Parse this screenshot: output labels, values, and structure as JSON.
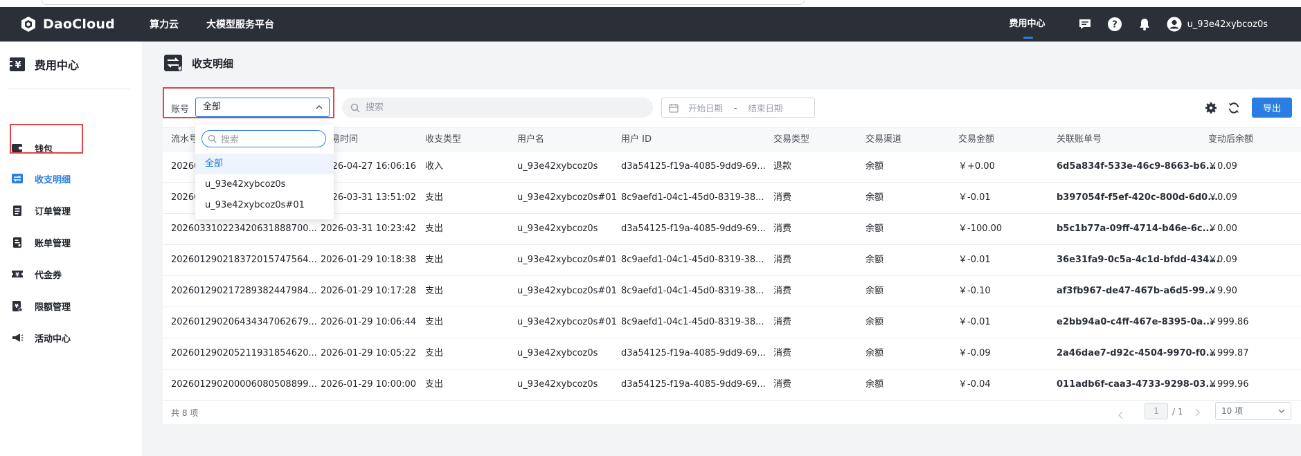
{
  "brand": {
    "name": "DaoCloud"
  },
  "topnav": {
    "items": [
      "算力云",
      "大模型服务平台"
    ]
  },
  "topright": {
    "cost_center": "费用中心",
    "username": "u_93e42xybcoz0s"
  },
  "sidebar": {
    "title": "费用中心",
    "items": [
      {
        "label": "钱包",
        "icon": "wallet-icon"
      },
      {
        "label": "收支明细",
        "icon": "transactions-icon"
      },
      {
        "label": "订单管理",
        "icon": "order-icon"
      },
      {
        "label": "账单管理",
        "icon": "bill-icon"
      },
      {
        "label": "代金券",
        "icon": "voucher-icon"
      },
      {
        "label": "限额管理",
        "icon": "limit-icon"
      },
      {
        "label": "活动中心",
        "icon": "megaphone-icon"
      }
    ]
  },
  "page": {
    "title": "收支明细"
  },
  "filters": {
    "account_label": "账号",
    "account_value": "全部",
    "search_placeholder": "搜索",
    "date_start_placeholder": "开始日期",
    "date_separator": "-",
    "date_end_placeholder": "结束日期",
    "export_label": "导出"
  },
  "dropdown": {
    "search_placeholder": "搜索",
    "options": [
      "全部",
      "u_93e42xybcoz0s",
      "u_93e42xybcoz0s#01"
    ],
    "selected": "全部"
  },
  "table": {
    "columns": [
      "流水号",
      "交易时间",
      "收支类型",
      "用户名",
      "用户 ID",
      "交易类型",
      "交易渠道",
      "交易金额",
      "关联账单号",
      "变动后余额"
    ],
    "visible_header_fragments": {
      "serial": "流水号",
      "time": "易时间"
    },
    "rows": [
      {
        "serial": "20260",
        "time": "2026-04-27 16:06:16",
        "dir": "收入",
        "user": "u_93e42xybcoz0s",
        "uid": "d3a54125-f19a-4085-9dd9-69...",
        "type": "退款",
        "channel": "余额",
        "amount": "￥+0.00",
        "bill": "6d5a834f-533e-46c9-8663-b6...",
        "balance": "￥0.09"
      },
      {
        "serial": "20260",
        "time": "2026-03-31 13:51:02",
        "dir": "支出",
        "user": "u_93e42xybcoz0s#01",
        "uid": "8c9aefd1-04c1-45d0-8319-38...",
        "type": "消费",
        "channel": "余额",
        "amount": "￥-0.01",
        "bill": "b397054f-f5ef-420c-800d-6d0...",
        "balance": "￥0.09"
      },
      {
        "serial": "2026033102234206318887​00...",
        "time": "2026-03-31 10:23:42",
        "dir": "支出",
        "user": "u_93e42xybcoz0s",
        "uid": "d3a54125-f19a-4085-9dd9-69...",
        "type": "消费",
        "channel": "余额",
        "amount": "￥-100.00",
        "bill": "b5c1b77a-09ff-4714-b46e-6c...",
        "balance": "￥0.00"
      },
      {
        "serial": "20260129021837201574​7564...",
        "time": "2026-01-29 10:18:38",
        "dir": "支出",
        "user": "u_93e42xybcoz0s#01",
        "uid": "8c9aefd1-04c1-45d0-8319-38...",
        "type": "消费",
        "channel": "余额",
        "amount": "￥-0.01",
        "bill": "36e31fa9-0c5a-4c1d-bfdd-434...",
        "balance": "￥0.09"
      },
      {
        "serial": "20260129021728938244​7984...",
        "time": "2026-01-29 10:17:28",
        "dir": "支出",
        "user": "u_93e42xybcoz0s#01",
        "uid": "8c9aefd1-04c1-45d0-8319-38...",
        "type": "消费",
        "channel": "余额",
        "amount": "￥-0.10",
        "bill": "af3fb967-de47-467b-a6d5-99...",
        "balance": "￥9.90"
      },
      {
        "serial": "20260129020643434706​2679...",
        "time": "2026-01-29 10:06:44",
        "dir": "支出",
        "user": "u_93e42xybcoz0s#01",
        "uid": "8c9aefd1-04c1-45d0-8319-38...",
        "type": "消费",
        "channel": "余额",
        "amount": "￥-0.01",
        "bill": "e2bb94a0-c4ff-467e-8395-0a...",
        "balance": "￥999.86"
      },
      {
        "serial": "20260129020521193185​4620...",
        "time": "2026-01-29 10:05:22",
        "dir": "支出",
        "user": "u_93e42xybcoz0s",
        "uid": "d3a54125-f19a-4085-9dd9-69...",
        "type": "消费",
        "channel": "余额",
        "amount": "￥-0.09",
        "bill": "2a46dae7-d92c-4504-9970-f0...",
        "balance": "￥999.87"
      },
      {
        "serial": "20260129020000608050​8899...",
        "time": "2026-01-29 10:00:00",
        "dir": "支出",
        "user": "u_93e42xybcoz0s",
        "uid": "d3a54125-f19a-4085-9dd9-69...",
        "type": "消费",
        "channel": "余额",
        "amount": "￥-0.04",
        "bill": "011adb6f-caa3-4733-9298-03...",
        "balance": "￥999.96"
      }
    ]
  },
  "pagination": {
    "total_text": "共 8 项",
    "current_page": "1",
    "total_pages_text": "/ 1",
    "page_size": "10 项"
  },
  "colors": {
    "accent": "#2a7de1",
    "topbar": "#2b2f38",
    "highlight_box": "#e0454b"
  }
}
